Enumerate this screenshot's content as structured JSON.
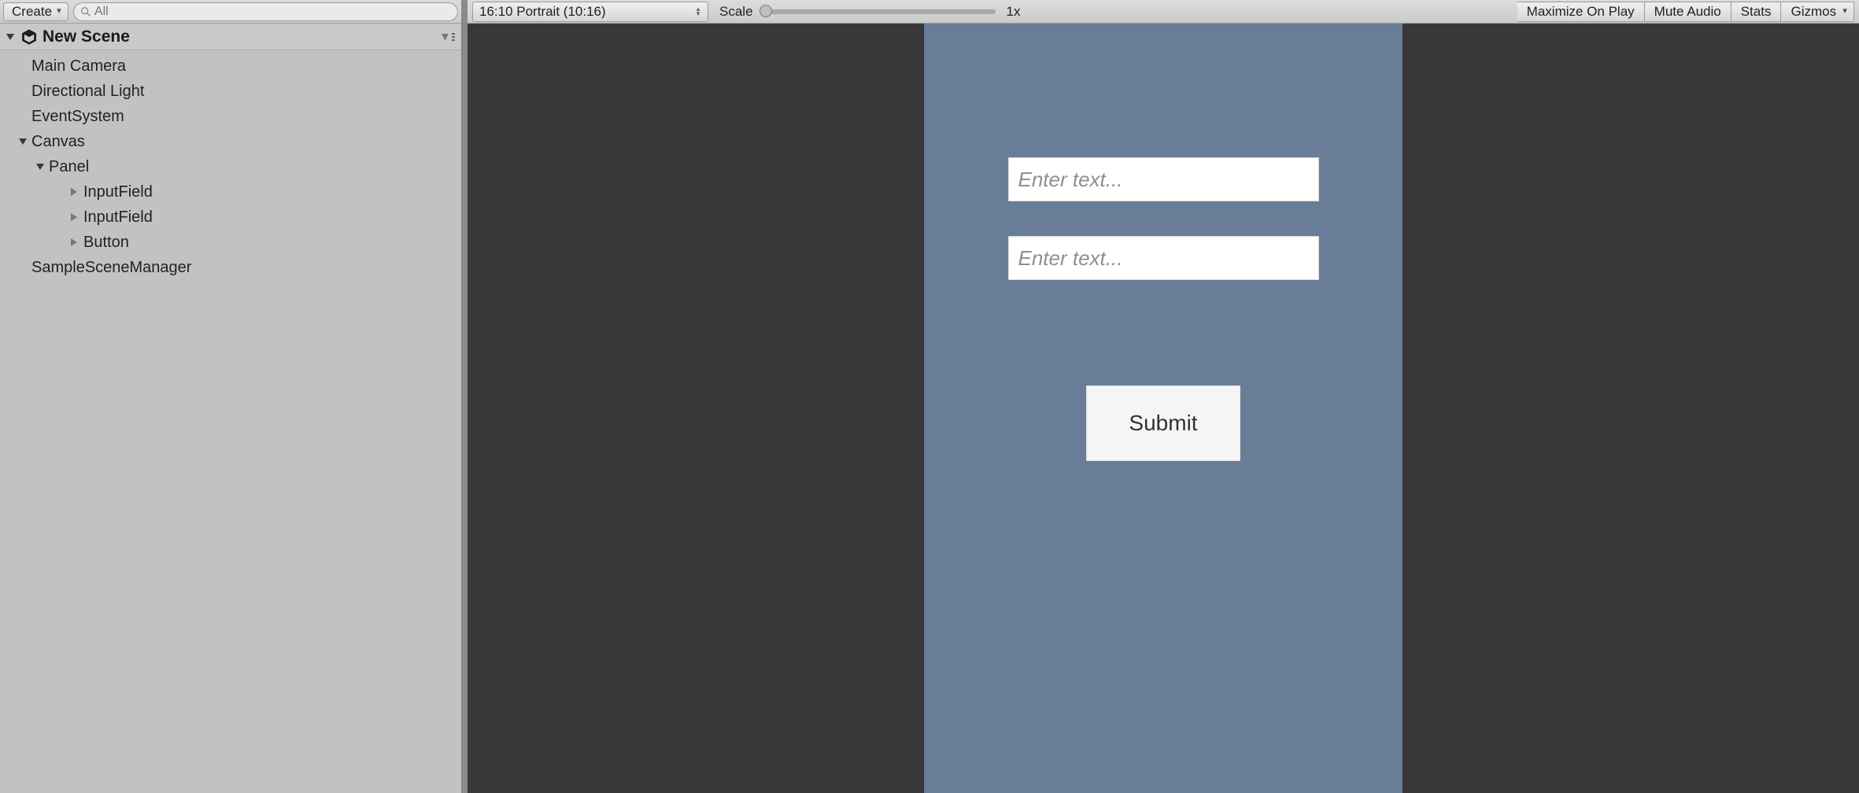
{
  "hierarchy": {
    "create_label": "Create",
    "search_placeholder": "All",
    "scene_name": "New Scene",
    "items": {
      "mainCamera": "Main Camera",
      "dirLight": "Directional Light",
      "eventSystem": "EventSystem",
      "canvas": "Canvas",
      "panel": "Panel",
      "input1": "InputField",
      "input2": "InputField",
      "button": "Button",
      "manager": "SampleSceneManager"
    }
  },
  "game_toolbar": {
    "aspect": "16:10 Portrait (10:16)",
    "scale_label": "Scale",
    "scale_value": "1x",
    "buttons": {
      "maximize": "Maximize On Play",
      "mute": "Mute Audio",
      "stats": "Stats",
      "gizmos": "Gizmos"
    }
  },
  "ui": {
    "input1_placeholder": "Enter text...",
    "input2_placeholder": "Enter text...",
    "submit_label": "Submit"
  }
}
